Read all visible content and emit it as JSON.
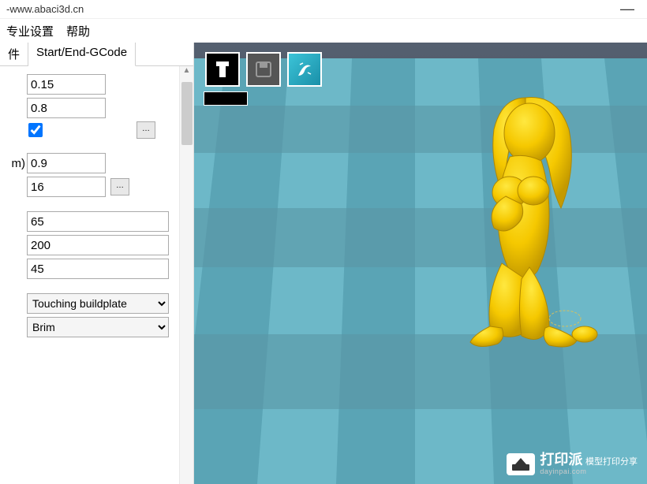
{
  "window": {
    "title_suffix": "-www.abaci3d.cn",
    "minimize": "—"
  },
  "menu": {
    "advanced": "专业设置",
    "help": "帮助"
  },
  "tabs": {
    "file": "件",
    "gcode": "Start/End-GCode"
  },
  "fields": {
    "layer_height": "0.15",
    "shell_thickness": "0.8",
    "checkbox_on": true,
    "label_m": "m)",
    "fill_density": "0.9",
    "count": "16",
    "speed": "65",
    "temp_ext": "200",
    "temp_bed": "45"
  },
  "dropdowns": {
    "support": "Touching buildplate",
    "adhesion": "Brim"
  },
  "watermark": {
    "name": "打印派",
    "sub": "模型打印分享",
    "url": "dayinpai.com"
  }
}
